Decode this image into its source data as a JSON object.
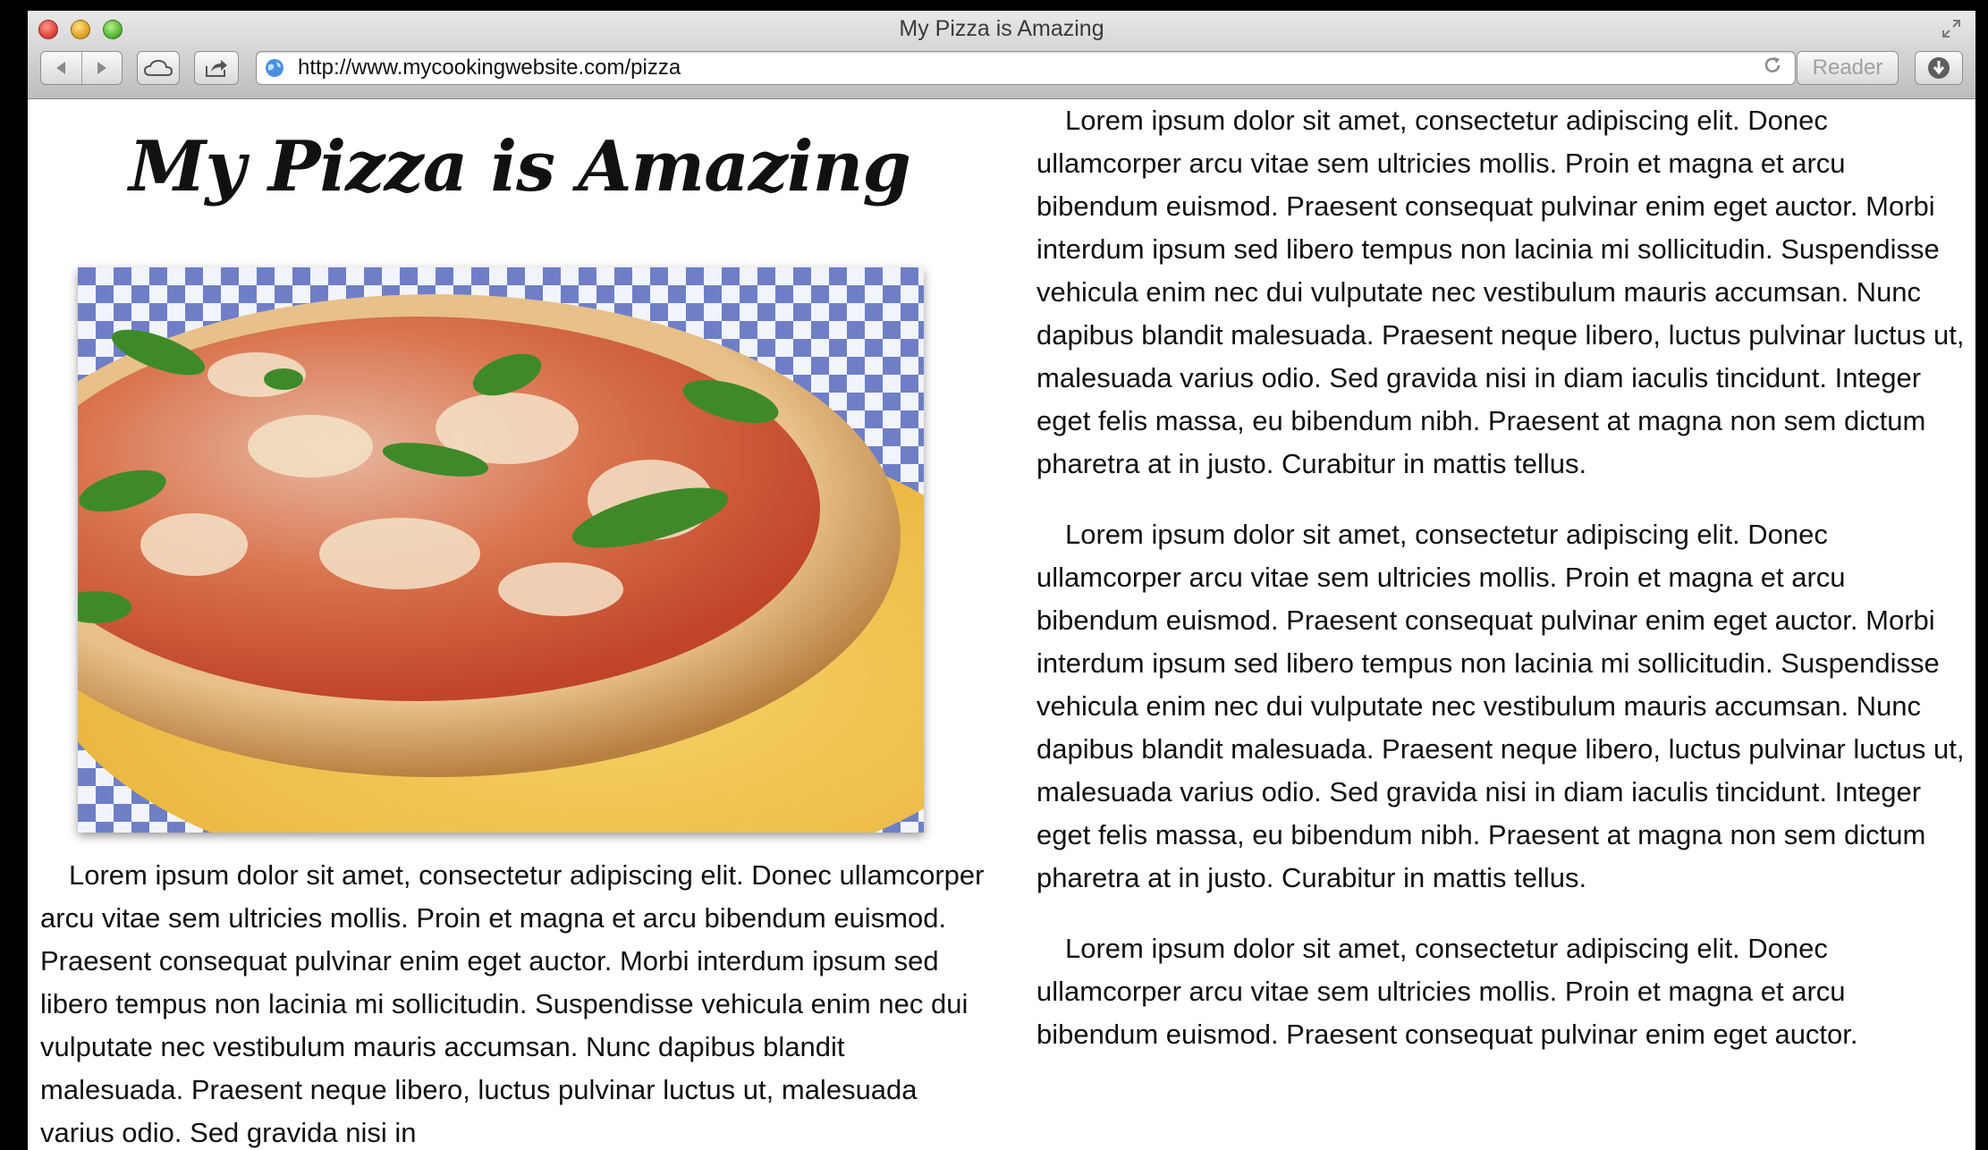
{
  "window": {
    "title": "My Pizza is Amazing"
  },
  "toolbar": {
    "url": "http://www.mycookingwebsite.com/pizza",
    "reader_label": "Reader"
  },
  "page": {
    "heading": "My Pizza is Amazing",
    "image_alt": "pizza photo",
    "left_paragraph": "Lorem ipsum dolor sit amet, consectetur adipiscing elit. Donec ullamcorper arcu vitae sem ultricies mollis. Proin et magna et arcu bibendum euismod. Praesent consequat pulvinar enim eget auctor. Morbi interdum ipsum sed libero tempus non lacinia mi sollicitudin. Suspendisse vehicula enim nec dui vulputate nec vestibulum mauris accumsan. Nunc dapibus blandit malesuada. Praesent neque libero, luctus pulvinar luctus ut, malesuada varius odio. Sed gravida nisi in",
    "right_paragraphs": [
      "Lorem ipsum dolor sit amet, consectetur adipiscing elit. Donec ullamcorper arcu vitae sem ultricies mollis. Proin et magna et arcu bibendum euismod. Praesent consequat pulvinar enim eget auctor. Morbi interdum ipsum sed libero tempus non lacinia mi sollicitudin. Suspendisse vehicula enim nec dui vulputate nec vestibulum mauris accumsan. Nunc dapibus blandit malesuada. Praesent neque libero, luctus pulvinar luctus ut, malesuada varius odio. Sed gravida nisi in diam iaculis tincidunt. Integer eget felis massa, eu bibendum nibh. Praesent at magna non sem dictum pharetra at in justo. Curabitur in mattis tellus.",
      "Lorem ipsum dolor sit amet, consectetur adipiscing elit. Donec ullamcorper arcu vitae sem ultricies mollis. Proin et magna et arcu bibendum euismod. Praesent consequat pulvinar enim eget auctor. Morbi interdum ipsum sed libero tempus non lacinia mi sollicitudin. Suspendisse vehicula enim nec dui vulputate nec vestibulum mauris accumsan. Nunc dapibus blandit malesuada. Praesent neque libero, luctus pulvinar luctus ut, malesuada varius odio. Sed gravida nisi in diam iaculis tincidunt. Integer eget felis massa, eu bibendum nibh. Praesent at magna non sem dictum pharetra at in justo. Curabitur in mattis tellus.",
      "Lorem ipsum dolor sit amet, consectetur adipiscing elit. Donec ullamcorper arcu vitae sem ultricies mollis. Proin et magna et arcu bibendum euismod. Praesent consequat pulvinar enim eget auctor."
    ]
  },
  "icons": {
    "close": "close-button-icon",
    "minimize": "minimize-button-icon",
    "zoom": "zoom-button-icon",
    "back": "back-arrow-icon",
    "forward": "forward-arrow-icon",
    "icloud": "cloud-icon",
    "share": "share-icon",
    "site": "globe-icon",
    "reload": "reload-icon",
    "downloads": "download-icon",
    "fullscreen": "fullscreen-icon"
  },
  "colors": {
    "close": "#e0443a",
    "minimize": "#e0a422",
    "zoom": "#55b838"
  }
}
